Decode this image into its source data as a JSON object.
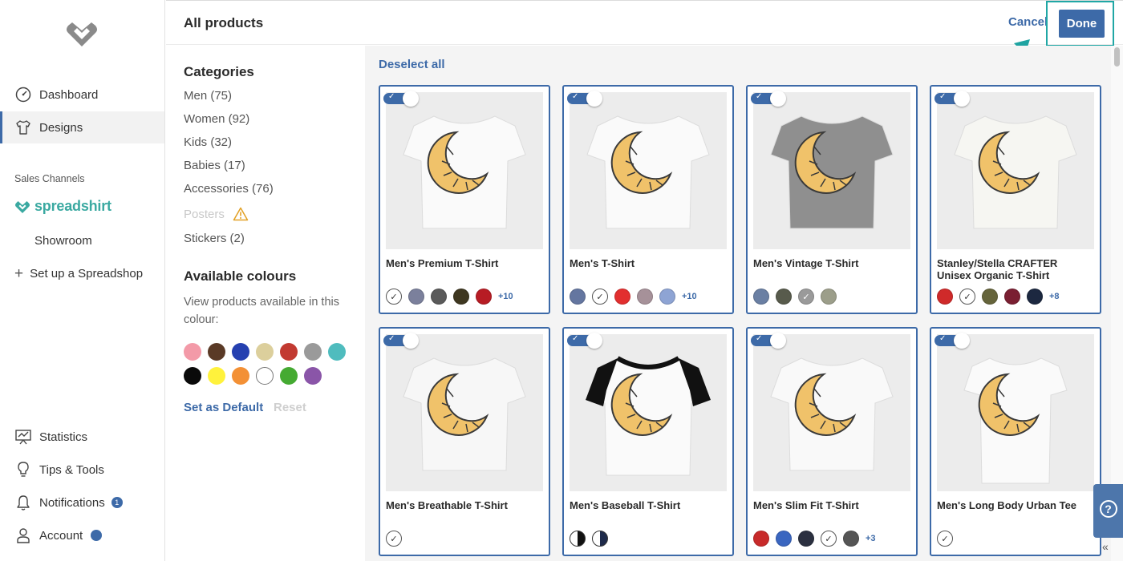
{
  "nav": {
    "items": [
      {
        "label": "Dashboard",
        "icon": "speedometer-icon"
      },
      {
        "label": "Designs",
        "icon": "tshirt-icon"
      }
    ],
    "sales_channels_label": "Sales Channels",
    "spreadshirt_label": "spreadshirt",
    "showroom_label": "Showroom",
    "setup_label": "Set up a Spreadshop",
    "bottom_items": [
      {
        "label": "Statistics",
        "icon": "presentation-chart-icon"
      },
      {
        "label": "Tips & Tools",
        "icon": "lightbulb-icon"
      },
      {
        "label": "Notifications",
        "icon": "bell-icon",
        "badge": "1"
      },
      {
        "label": "Account",
        "icon": "person-icon"
      }
    ]
  },
  "header": {
    "title": "All products",
    "cancel_label": "Cancel",
    "done_label": "Done"
  },
  "filters": {
    "categories_title": "Categories",
    "categories": [
      "Men (75)",
      "Women (92)",
      "Kids (32)",
      "Babies (17)",
      "Accessories (76)",
      "Posters",
      "Stickers (2)"
    ],
    "colours_title": "Available colours",
    "colours_desc": "View products available in this colour:",
    "swatches": [
      "#f39aa8",
      "#5a3a26",
      "#2540b0",
      "#dccf9c",
      "#c23a31",
      "#9a9a9a",
      "#4fbcbe",
      "#0a0a0a",
      "#fff23c",
      "#f39035",
      "#ffffff",
      "#45aa32",
      "#8a55a8"
    ],
    "set_default_label": "Set as Default",
    "reset_label": "Reset"
  },
  "products": {
    "deselect_label": "Deselect all",
    "cards": [
      {
        "name": "Men's Premium T-Shirt",
        "colors": [
          "#ffffff",
          "#7b809c",
          "#5a5a5a",
          "#3e3720",
          "#b71c24"
        ],
        "more": "+10"
      },
      {
        "name": "Men's T-Shirt",
        "colors": [
          "#6476a0",
          "#ffffff",
          "#e22f2f",
          "#a69199",
          "#8ea4d4"
        ],
        "more": "+10"
      },
      {
        "name": "Men's Vintage T-Shirt",
        "colors": [
          "#6a7fa3",
          "#585b4c",
          "#9a9a9a",
          "#9c9e8a"
        ],
        "more": ""
      },
      {
        "name": "Stanley/Stella CRAFTER Unisex Organic T-Shirt",
        "colors": [
          "#cf2a2a",
          "#ffffff",
          "#65643b",
          "#7a1f32",
          "#1c2840"
        ],
        "more": "+8"
      },
      {
        "name": "Men's Breathable T-Shirt",
        "colors": [
          "#ffffff"
        ],
        "more": ""
      },
      {
        "name": "Men's Baseball T-Shirt",
        "colors": [
          "#111111",
          "#1e2a4a"
        ],
        "more": ""
      },
      {
        "name": "Men's Slim Fit T-Shirt",
        "colors": [
          "#c82a2a",
          "#3a66c0",
          "#2b3040",
          "#ffffff",
          "#555555"
        ],
        "more": "+3"
      },
      {
        "name": "Men's Long Body Urban Tee",
        "colors": [
          "#ffffff"
        ],
        "more": ""
      }
    ]
  }
}
